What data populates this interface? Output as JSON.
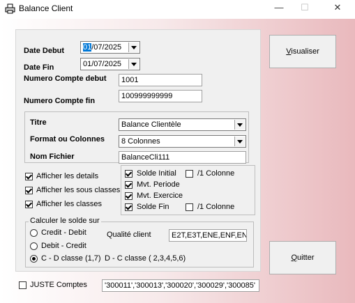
{
  "window": {
    "title": "Balance Client",
    "minimize": "—",
    "maximize": "☐",
    "close": "✕"
  },
  "form": {
    "date_debut_label": "Date Debut",
    "date_debut_prefix": "01",
    "date_debut_rest": "/07/2025",
    "date_fin_label": "Date Fin",
    "date_fin_value": "01/07/2025",
    "compte_debut_label": "Numero Compte debut",
    "compte_debut_value": "1001",
    "compte_fin_label": "Numero Compte fin",
    "compte_fin_value": "100999999999"
  },
  "options": {
    "titre_label": "Titre",
    "titre_value": "Balance Clientèle",
    "format_label": "Format ou Colonnes",
    "format_value": "8 Colonnes",
    "fichier_label": "Nom  Fichier",
    "fichier_value": "BalanceCli111"
  },
  "checks_left": [
    {
      "label": "Afficher les details",
      "checked": true
    },
    {
      "label": "Afficher les sous classes",
      "checked": true
    },
    {
      "label": "Afficher les classes",
      "checked": true
    }
  ],
  "checks_right": {
    "solde_initial": "Solde Initial",
    "col1_a": "/1 Colonne",
    "mvt_periode": "Mvt. Periode",
    "mvt_exercice": "Mvt. Exercice",
    "solde_fin": "Solde Fin",
    "col1_b": "/1 Colonne"
  },
  "solde": {
    "group_title": "Calculer le solde sur",
    "radio1": "Credit - Debit",
    "radio2": "Debit - Credit",
    "radio3": "C - D classe (1,7)",
    "dc_text": "D - C classe ( 2,3,4,5,6)",
    "qualite_label": "Qualité client",
    "qualite_value": "E2T,E3T,ENE,ENF,EN"
  },
  "bottom": {
    "juste_label": "JUSTE Comptes",
    "juste_value": "'300011','300013','300020','300029','300085'"
  },
  "buttons": {
    "visualiser_first": "V",
    "visualiser_rest": "isualiser",
    "quitter_first": "Q",
    "quitter_rest": "uitter"
  }
}
